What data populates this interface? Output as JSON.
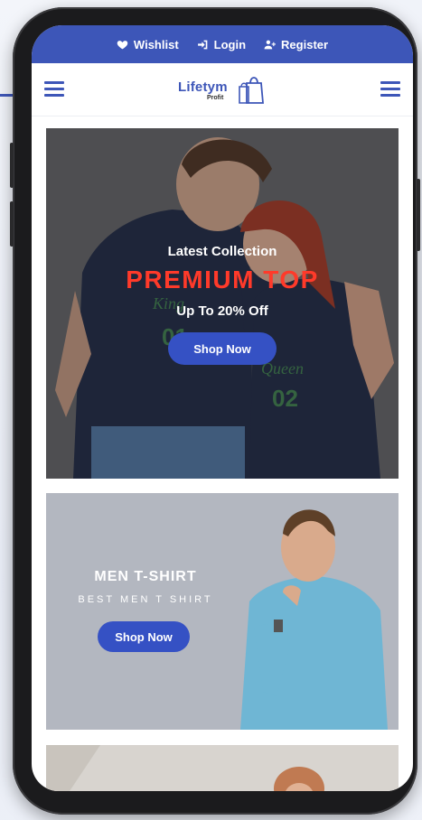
{
  "topbar": {
    "wishlist": "Wishlist",
    "login": "Login",
    "register": "Register"
  },
  "logo": {
    "name": "Lifetym",
    "tagline": "Profit"
  },
  "hero": {
    "subtitle": "Latest Collection",
    "title": "PREMIUM TOP",
    "offer": "Up To 20% Off",
    "cta": "Shop Now",
    "shirt_left_text": "King",
    "shirt_left_number": "01",
    "shirt_right_text": "Queen",
    "shirt_right_number": "02"
  },
  "men_banner": {
    "title": "MEN T-SHIRT",
    "subtitle": "BEST MEN T SHIRT",
    "cta": "Shop Now"
  },
  "colors": {
    "accent": "#3d56b8",
    "button": "#3551c4",
    "premium_text": "#ff3a2a",
    "shirt_navy": "#1e2740",
    "shirt_print_green": "#3c7a4a"
  }
}
